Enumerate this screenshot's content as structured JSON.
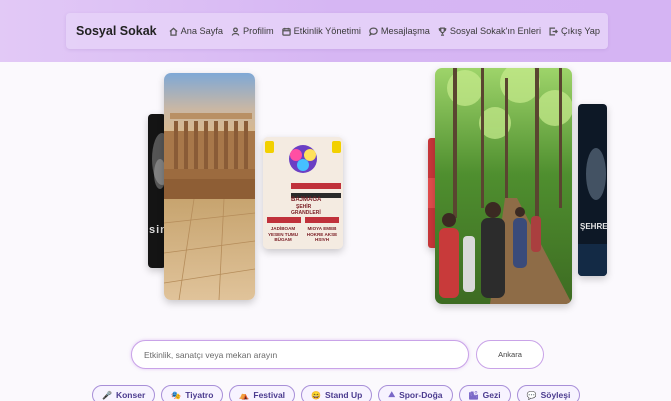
{
  "nav": {
    "brand": "Sosyal Sokak",
    "items": [
      {
        "label": "Ana Sayfa",
        "icon": "home-icon"
      },
      {
        "label": "Profilim",
        "icon": "user-icon"
      },
      {
        "label": "Etkinlik Yönetimi",
        "icon": "calendar-icon"
      },
      {
        "label": "Mesajlaşma",
        "icon": "chat-bubble-icon"
      },
      {
        "label": "Sosyal Sokak'ın Enleri",
        "icon": "trophy-icon"
      },
      {
        "label": "Çıkış Yap",
        "icon": "logout-icon"
      }
    ]
  },
  "carousel": {
    "poster_text": {
      "line1": "BAJMAGA",
      "line2": "ŞEHİR",
      "line3": "GRANDLERİ",
      "left_block": "JADİBOAM YESEN TUMU BÜGAM",
      "right_block": "MIOYA EMEB HOKRE AKSE HSIVH",
      "left_dark_letters": "sini",
      "right_dark_letters": "ŞEHRE"
    }
  },
  "search": {
    "placeholder": "Etkinlik, sanatçı veya mekan arayın",
    "city": "Ankara"
  },
  "categories": [
    {
      "label": "Konser",
      "icon": "microphone-icon",
      "glyph": "🎤"
    },
    {
      "label": "Tiyatro",
      "icon": "theater-masks-icon",
      "glyph": "🎭"
    },
    {
      "label": "Festival",
      "icon": "festival-tent-icon",
      "glyph": "⛺"
    },
    {
      "label": "Stand Up",
      "icon": "laughing-face-icon",
      "glyph": "😄"
    },
    {
      "label": "Spor-Doğa",
      "icon": "outdoor-icon",
      "glyph": "⛰"
    },
    {
      "label": "Gezi",
      "icon": "travel-icon",
      "glyph": "🏙"
    },
    {
      "label": "Söyleşi",
      "icon": "speech-bubble-icon",
      "glyph": "💬"
    }
  ],
  "colors": {
    "header_gradient_start": "#e2c9f6",
    "header_gradient_end": "#d5b4f3",
    "chip_border": "#a88fd8",
    "chip_text": "#4b3b8f",
    "search_border": "#c9a3e8"
  }
}
